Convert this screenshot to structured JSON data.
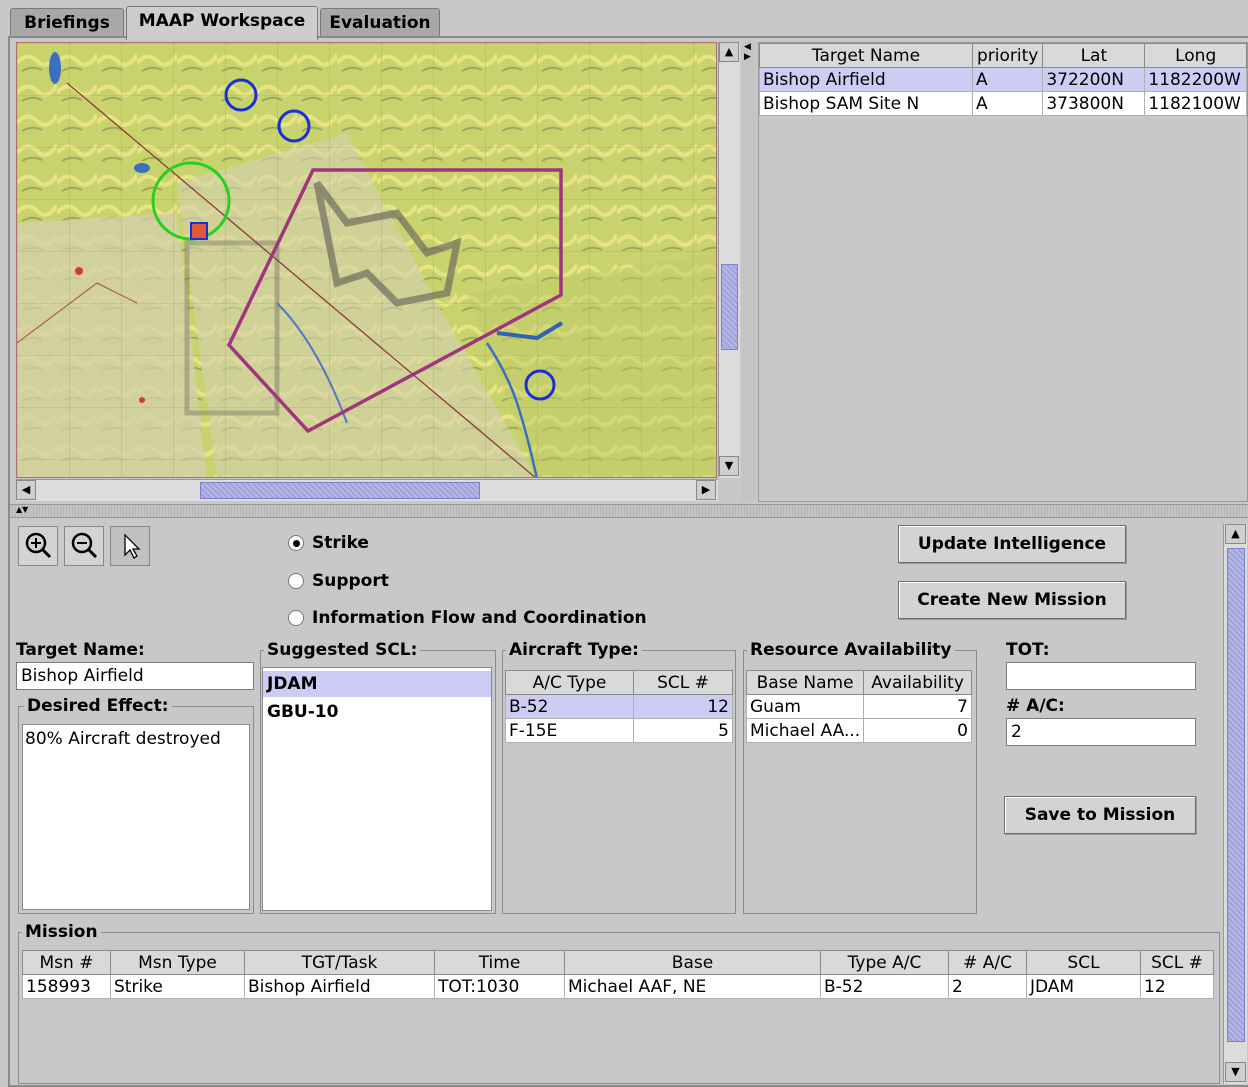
{
  "tabs": [
    {
      "label": "Briefings"
    },
    {
      "label": "MAAP Workspace"
    },
    {
      "label": "Evaluation"
    }
  ],
  "target_table": {
    "headers": [
      "Target Name",
      "priority",
      "Lat",
      "Long"
    ],
    "rows": [
      [
        "Bishop Airfield",
        "A",
        "372200N",
        "1182200W"
      ],
      [
        "Bishop SAM Site N",
        "A",
        "373800N",
        "1182100W"
      ]
    ]
  },
  "mission_type": {
    "options": [
      "Strike",
      "Support",
      "Information Flow and Coordination"
    ],
    "selected": "Strike"
  },
  "buttons": {
    "update_intelligence": "Update Intelligence",
    "create_new_mission": "Create New Mission",
    "save_to_mission": "Save to Mission"
  },
  "target_name": {
    "label": "Target Name:",
    "value": "Bishop Airfield"
  },
  "desired_effect": {
    "label": "Desired Effect:",
    "value": "80% Aircraft destroyed"
  },
  "suggested_scl": {
    "label": "Suggested SCL:",
    "items": [
      "JDAM",
      "GBU-10"
    ]
  },
  "aircraft_type": {
    "label": "Aircraft Type:",
    "headers": [
      "A/C Type",
      "SCL #"
    ],
    "rows": [
      [
        "B-52",
        "12"
      ],
      [
        "F-15E",
        "5"
      ]
    ]
  },
  "resource_availability": {
    "label": "Resource Availability",
    "headers": [
      "Base Name",
      "Availability"
    ],
    "rows": [
      [
        "Guam",
        "7"
      ],
      [
        "Michael AA...",
        "0"
      ]
    ]
  },
  "tot": {
    "label": "TOT:",
    "value": ""
  },
  "num_ac": {
    "label": "# A/C:",
    "value": "2"
  },
  "mission": {
    "label": "Mission",
    "headers": [
      "Msn #",
      "Msn Type",
      "TGT/Task",
      "Time",
      "Base",
      "Type A/C",
      "# A/C",
      "SCL",
      "SCL #"
    ],
    "rows": [
      [
        "158993",
        "Strike",
        "Bishop Airfield",
        "TOT:1030",
        "Michael AAF, NE",
        "B-52",
        "2",
        "JDAM",
        "12"
      ]
    ]
  },
  "icons": [
    "zoom-in-icon",
    "zoom-out-icon",
    "pointer-icon"
  ]
}
